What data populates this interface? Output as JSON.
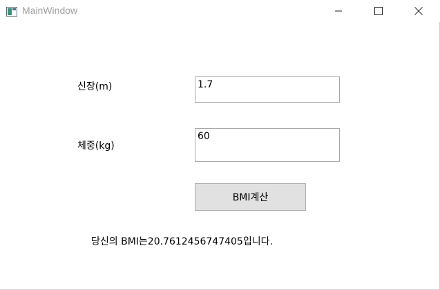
{
  "window": {
    "title": "MainWindow"
  },
  "form": {
    "height_label": "신장(m)",
    "height_value": "1.7",
    "weight_label": "체중(kg)",
    "weight_value": "60",
    "calc_button_label": "BMI계산",
    "result_text": "당신의 BMI는20.7612456747405입니다."
  },
  "icons": {
    "app": "window-app-icon",
    "minimize": "minimize-icon",
    "maximize": "maximize-icon",
    "close": "close-icon"
  }
}
